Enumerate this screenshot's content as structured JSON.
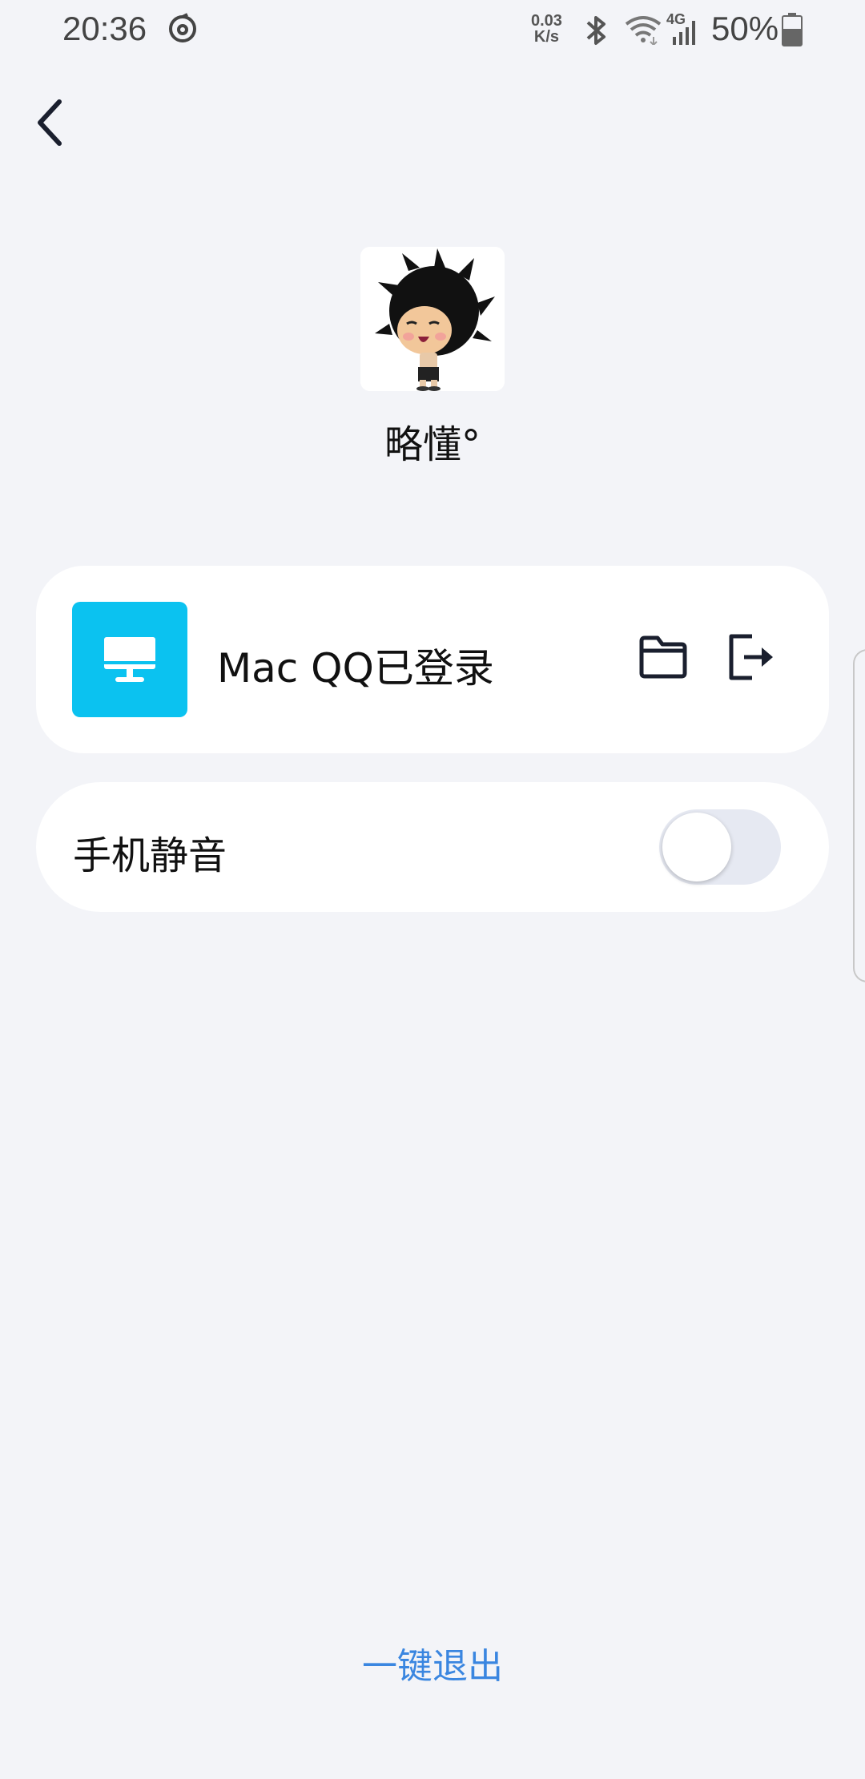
{
  "status_bar": {
    "time": "20:36",
    "speed_value": "0.03",
    "speed_unit": "K/s",
    "network_type": "4G",
    "battery": "50%",
    "icons": [
      "netease-music-icon",
      "bluetooth-icon",
      "wifi-icon",
      "signal-icon",
      "battery-icon"
    ]
  },
  "header": {
    "back_icon": "chevron-left-icon"
  },
  "profile": {
    "nickname": "略懂°"
  },
  "device_card": {
    "icon": "monitor-icon",
    "icon_color": "#0bc2f0",
    "label": "Mac QQ已登录",
    "actions": [
      "folder-icon",
      "logout-icon"
    ]
  },
  "mute_setting": {
    "label": "手机静音",
    "enabled": false
  },
  "footer": {
    "exit_all_label": "一键退出",
    "link_color": "#3a86e0"
  }
}
